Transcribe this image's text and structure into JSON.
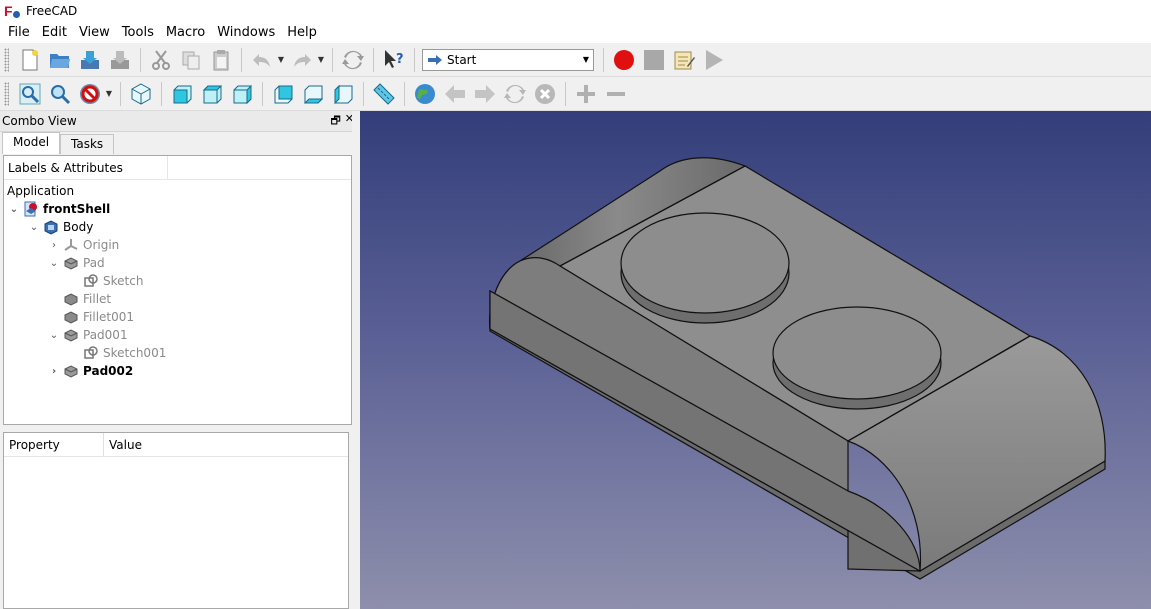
{
  "window": {
    "title": "FreeCAD"
  },
  "menu": [
    "File",
    "Edit",
    "View",
    "Tools",
    "Macro",
    "Windows",
    "Help"
  ],
  "workbench": {
    "selected": "Start"
  },
  "combo_view": {
    "title": "Combo View",
    "tabs": [
      "Model",
      "Tasks"
    ],
    "active_tab": "Model"
  },
  "tree": {
    "header": "Labels & Attributes",
    "group": "Application",
    "items": [
      {
        "label": "frontShell",
        "level": 0,
        "expander": "open",
        "style": "bold",
        "icon": "document-icon"
      },
      {
        "label": "Body",
        "level": 1,
        "expander": "open",
        "style": "normal",
        "icon": "body-icon"
      },
      {
        "label": "Origin",
        "level": 2,
        "expander": "closed",
        "style": "dim",
        "icon": "origin-icon"
      },
      {
        "label": "Pad",
        "level": 2,
        "expander": "open",
        "style": "dim",
        "icon": "pad-icon"
      },
      {
        "label": "Sketch",
        "level": 3,
        "expander": "none",
        "style": "dim",
        "icon": "sketch-icon"
      },
      {
        "label": "Fillet",
        "level": 2,
        "expander": "none",
        "style": "dim",
        "icon": "fillet-icon"
      },
      {
        "label": "Fillet001",
        "level": 2,
        "expander": "none",
        "style": "dim",
        "icon": "fillet-icon"
      },
      {
        "label": "Pad001",
        "level": 2,
        "expander": "open",
        "style": "dim",
        "icon": "pad-icon"
      },
      {
        "label": "Sketch001",
        "level": 3,
        "expander": "none",
        "style": "dim",
        "icon": "sketch-icon"
      },
      {
        "label": "Pad002",
        "level": 2,
        "expander": "closed",
        "style": "bold",
        "icon": "pad-icon"
      }
    ]
  },
  "property_view": {
    "col_property": "Property",
    "col_value": "Value"
  },
  "colors": {
    "record": "#e01010",
    "model_fill": "#8a8a8a",
    "viewport_top": "#333e7a",
    "viewport_bottom": "#8e8fac"
  }
}
